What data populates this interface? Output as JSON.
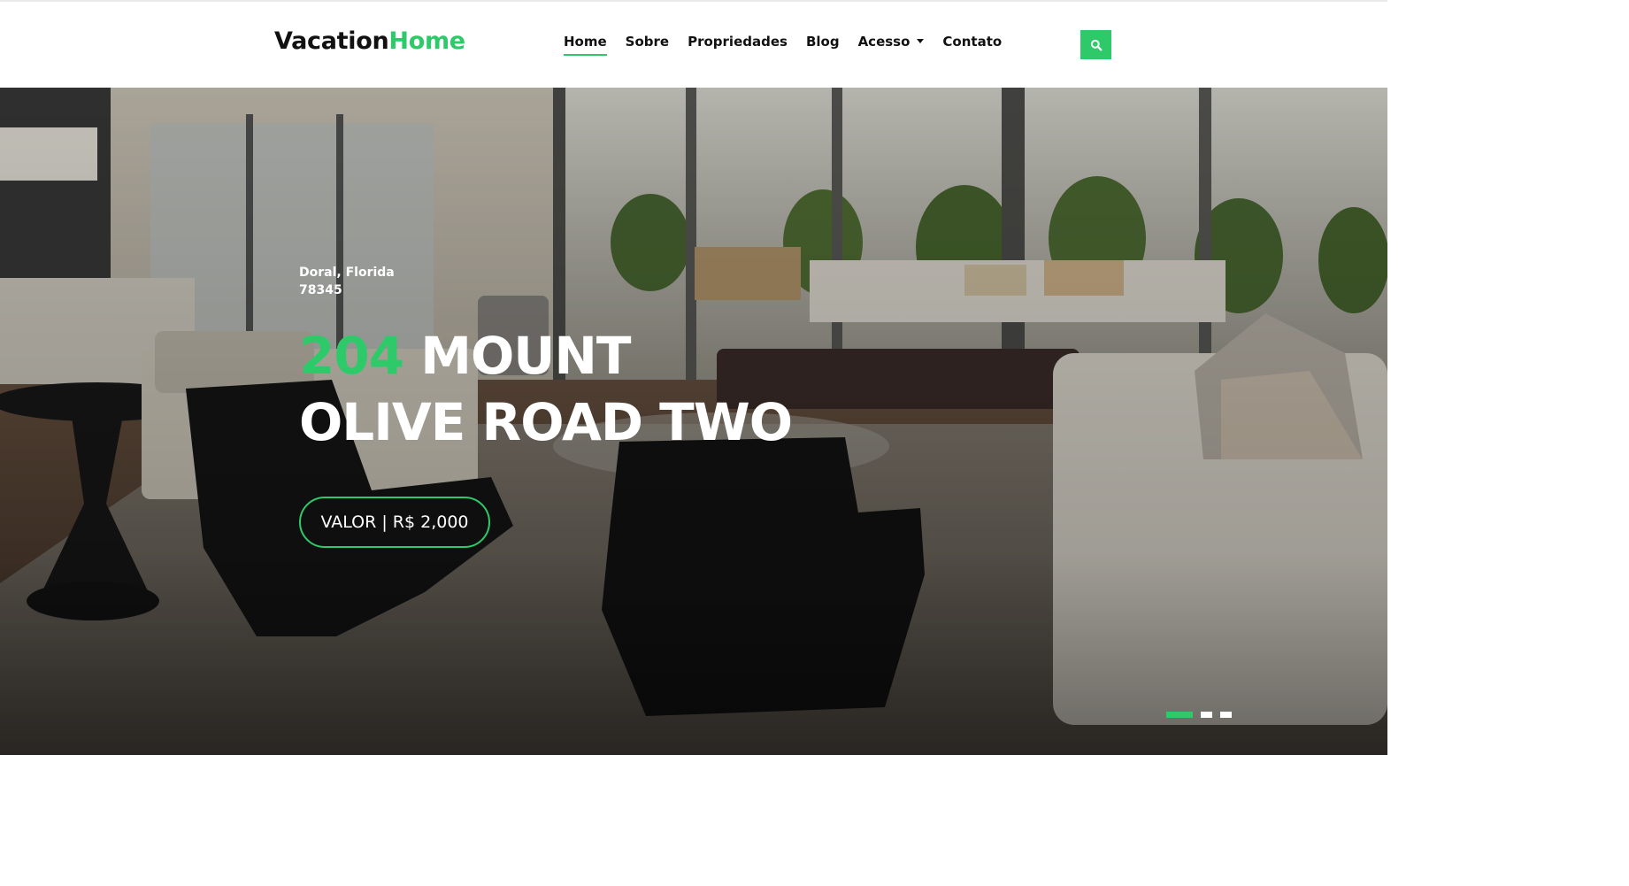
{
  "brand": {
    "name_part1": "Vacation",
    "name_part2": "Home"
  },
  "nav": {
    "items": [
      {
        "label": "Home",
        "active": true
      },
      {
        "label": "Sobre"
      },
      {
        "label": "Propriedades"
      },
      {
        "label": "Blog"
      },
      {
        "label": "Acesso",
        "has_dropdown": true
      },
      {
        "label": "Contato"
      }
    ]
  },
  "search": {
    "icon": "search-icon"
  },
  "hero": {
    "location_line1": "Doral, Florida",
    "location_line2": "78345",
    "title_number": "204",
    "title_line1_rest": " MOUNT",
    "title_line2": "OLIVE ROAD TWO",
    "price_label": "VALOR | R$ 2,000"
  },
  "carousel": {
    "slides": 3,
    "active_index": 0
  },
  "colors": {
    "accent": "#2eca6a",
    "text": "#111111"
  }
}
